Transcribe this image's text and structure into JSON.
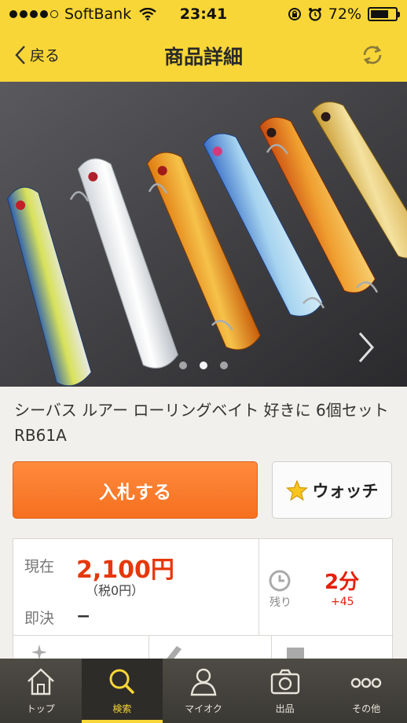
{
  "status_bar": {
    "carrier": "SoftBank",
    "time": "23:41",
    "battery": "72%",
    "signal_bars": 4
  },
  "nav": {
    "back_label": "戻る",
    "title": "商品詳細"
  },
  "gallery": {
    "page_count": 3,
    "active_page": 1
  },
  "item": {
    "title": "シーバス ルアー ローリングベイト 好きに 6個セット RB61A"
  },
  "actions": {
    "bid_label": "入札する",
    "watch_label": "ウォッチ"
  },
  "info": {
    "current_label": "現在",
    "current_price": "2,100円",
    "tax_note": "（税0円）",
    "buyout_label": "即決",
    "buyout_value": "−",
    "remaining_label": "残り",
    "remaining_time": "2分",
    "bid_count": "+45"
  },
  "tabs": [
    {
      "label": "トップ",
      "icon": "home-icon"
    },
    {
      "label": "検索",
      "icon": "search-icon",
      "active": true
    },
    {
      "label": "マイオク",
      "icon": "person-icon"
    },
    {
      "label": "出品",
      "icon": "camera-icon"
    },
    {
      "label": "その他",
      "icon": "more-icon"
    }
  ],
  "colors": {
    "brand_yellow": "#f8d637",
    "bid_orange": "#f5701f",
    "price_red": "#e5380c"
  }
}
